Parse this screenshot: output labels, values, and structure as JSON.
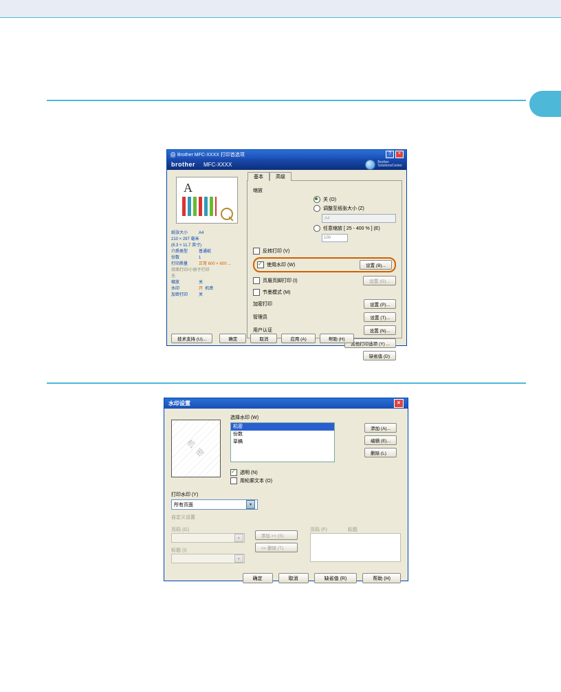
{
  "dlg1": {
    "title_prefix": "🖨 Brother MFC-XXXX",
    "title_suffix": "打印首选项",
    "brand": "brother",
    "model": "MFC-XXXX",
    "solutions_center_l1": "Brother",
    "solutions_center_l2": "SolutionsCenter",
    "left": {
      "paper_size_key": "纸张大小",
      "paper_size_val": "A4",
      "paper_dims": "210 × 297 毫米",
      "paper_dims2": "(8.3 × 11.7 英寸)",
      "media_key": "介质类型",
      "media_val": "普通纸",
      "copies_key": "份数",
      "copies_val": "1",
      "quality_key": "打印质量",
      "quality_val": "正常 600 × 600 ...",
      "duplex": "双面打印/小册子打印",
      "none": "无",
      "scale_key": "缩放",
      "scale_val": "关",
      "wm_key": "水印",
      "wm_on": "开",
      "wm_name": "机密",
      "secure_key": "加密打印",
      "secure_val": "关"
    },
    "tabs": {
      "basic": "基本",
      "advanced": "高级"
    },
    "panel": {
      "scale_label": "缩放",
      "radio_off": "关 (O)",
      "radio_fit": "调整至纸张大小 (Z)",
      "fit_value": "A4",
      "radio_free": "任意缩放 [ 25 - 400 % ] (E)",
      "free_value": "100",
      "chk_reverse": "反转打印 (V)",
      "chk_watermark": "使用水印 (W)",
      "chk_header": "页眉页脚打印 (I)",
      "chk_toner": "节墨模式 (M)",
      "lbl_secure": "加密打印",
      "lbl_admin": "管理员",
      "lbl_userauth": "用户认证",
      "btn_settings": "设置 (B)...",
      "btn_settings2": "设置 (G)...",
      "btn_settings3": "设置 (P)...",
      "btn_settings4": "设置 (T)...",
      "btn_settings5": "设置 (N)...",
      "btn_other": "其他打印选项 (Y) ...",
      "btn_default_r": "缺省值 (D)"
    },
    "footer": {
      "support": "技术支持 (U)...",
      "ok": "确定",
      "cancel": "取消",
      "apply": "应用 (A)",
      "help": "帮助 (H)"
    }
  },
  "dlg2": {
    "title": "水印设置",
    "select_wm": "选择水印 (W)",
    "list": [
      "机密",
      "份数",
      "草稿"
    ],
    "wm_preview_text": "机 密",
    "btn_add": "添加 (A)...",
    "btn_edit": "编辑 (E)...",
    "btn_del": "删除 (L)",
    "chk_transparent": "透明 (N)",
    "chk_outline": "用轮廓文本 (O)",
    "print_wm": "打印水印 (Y)",
    "print_wm_val": "所有页面",
    "custom": "自定义设置",
    "page_l": "页码 (G)",
    "title_l": "标题 (I)",
    "btn_addpg": "添加 >> (S)",
    "btn_delpg": "<< 删除 (T)",
    "page_r": "页码 (F)",
    "title_r": "标题",
    "footer": {
      "ok": "确定",
      "cancel": "取消",
      "default": "缺省值 (R)",
      "help": "帮助 (H)"
    }
  }
}
